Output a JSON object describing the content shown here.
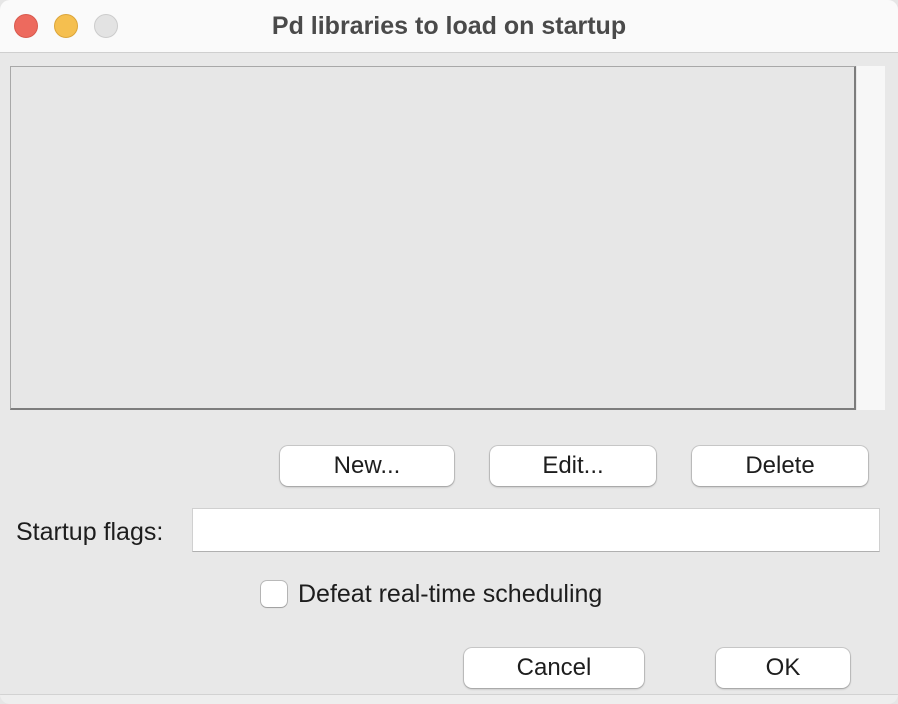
{
  "window": {
    "title": "Pd libraries to load on startup",
    "colors": {
      "close": "#ed6a5e",
      "minimize": "#f5bf4f",
      "zoom": "#e3e3e3"
    }
  },
  "library_list": {
    "items": []
  },
  "list_actions": {
    "new_label": "New...",
    "edit_label": "Edit...",
    "delete_label": "Delete"
  },
  "startup_flags": {
    "label": "Startup flags:",
    "value": ""
  },
  "realtime": {
    "label": "Defeat real-time scheduling",
    "checked": false
  },
  "dialog_actions": {
    "cancel_label": "Cancel",
    "ok_label": "OK"
  }
}
